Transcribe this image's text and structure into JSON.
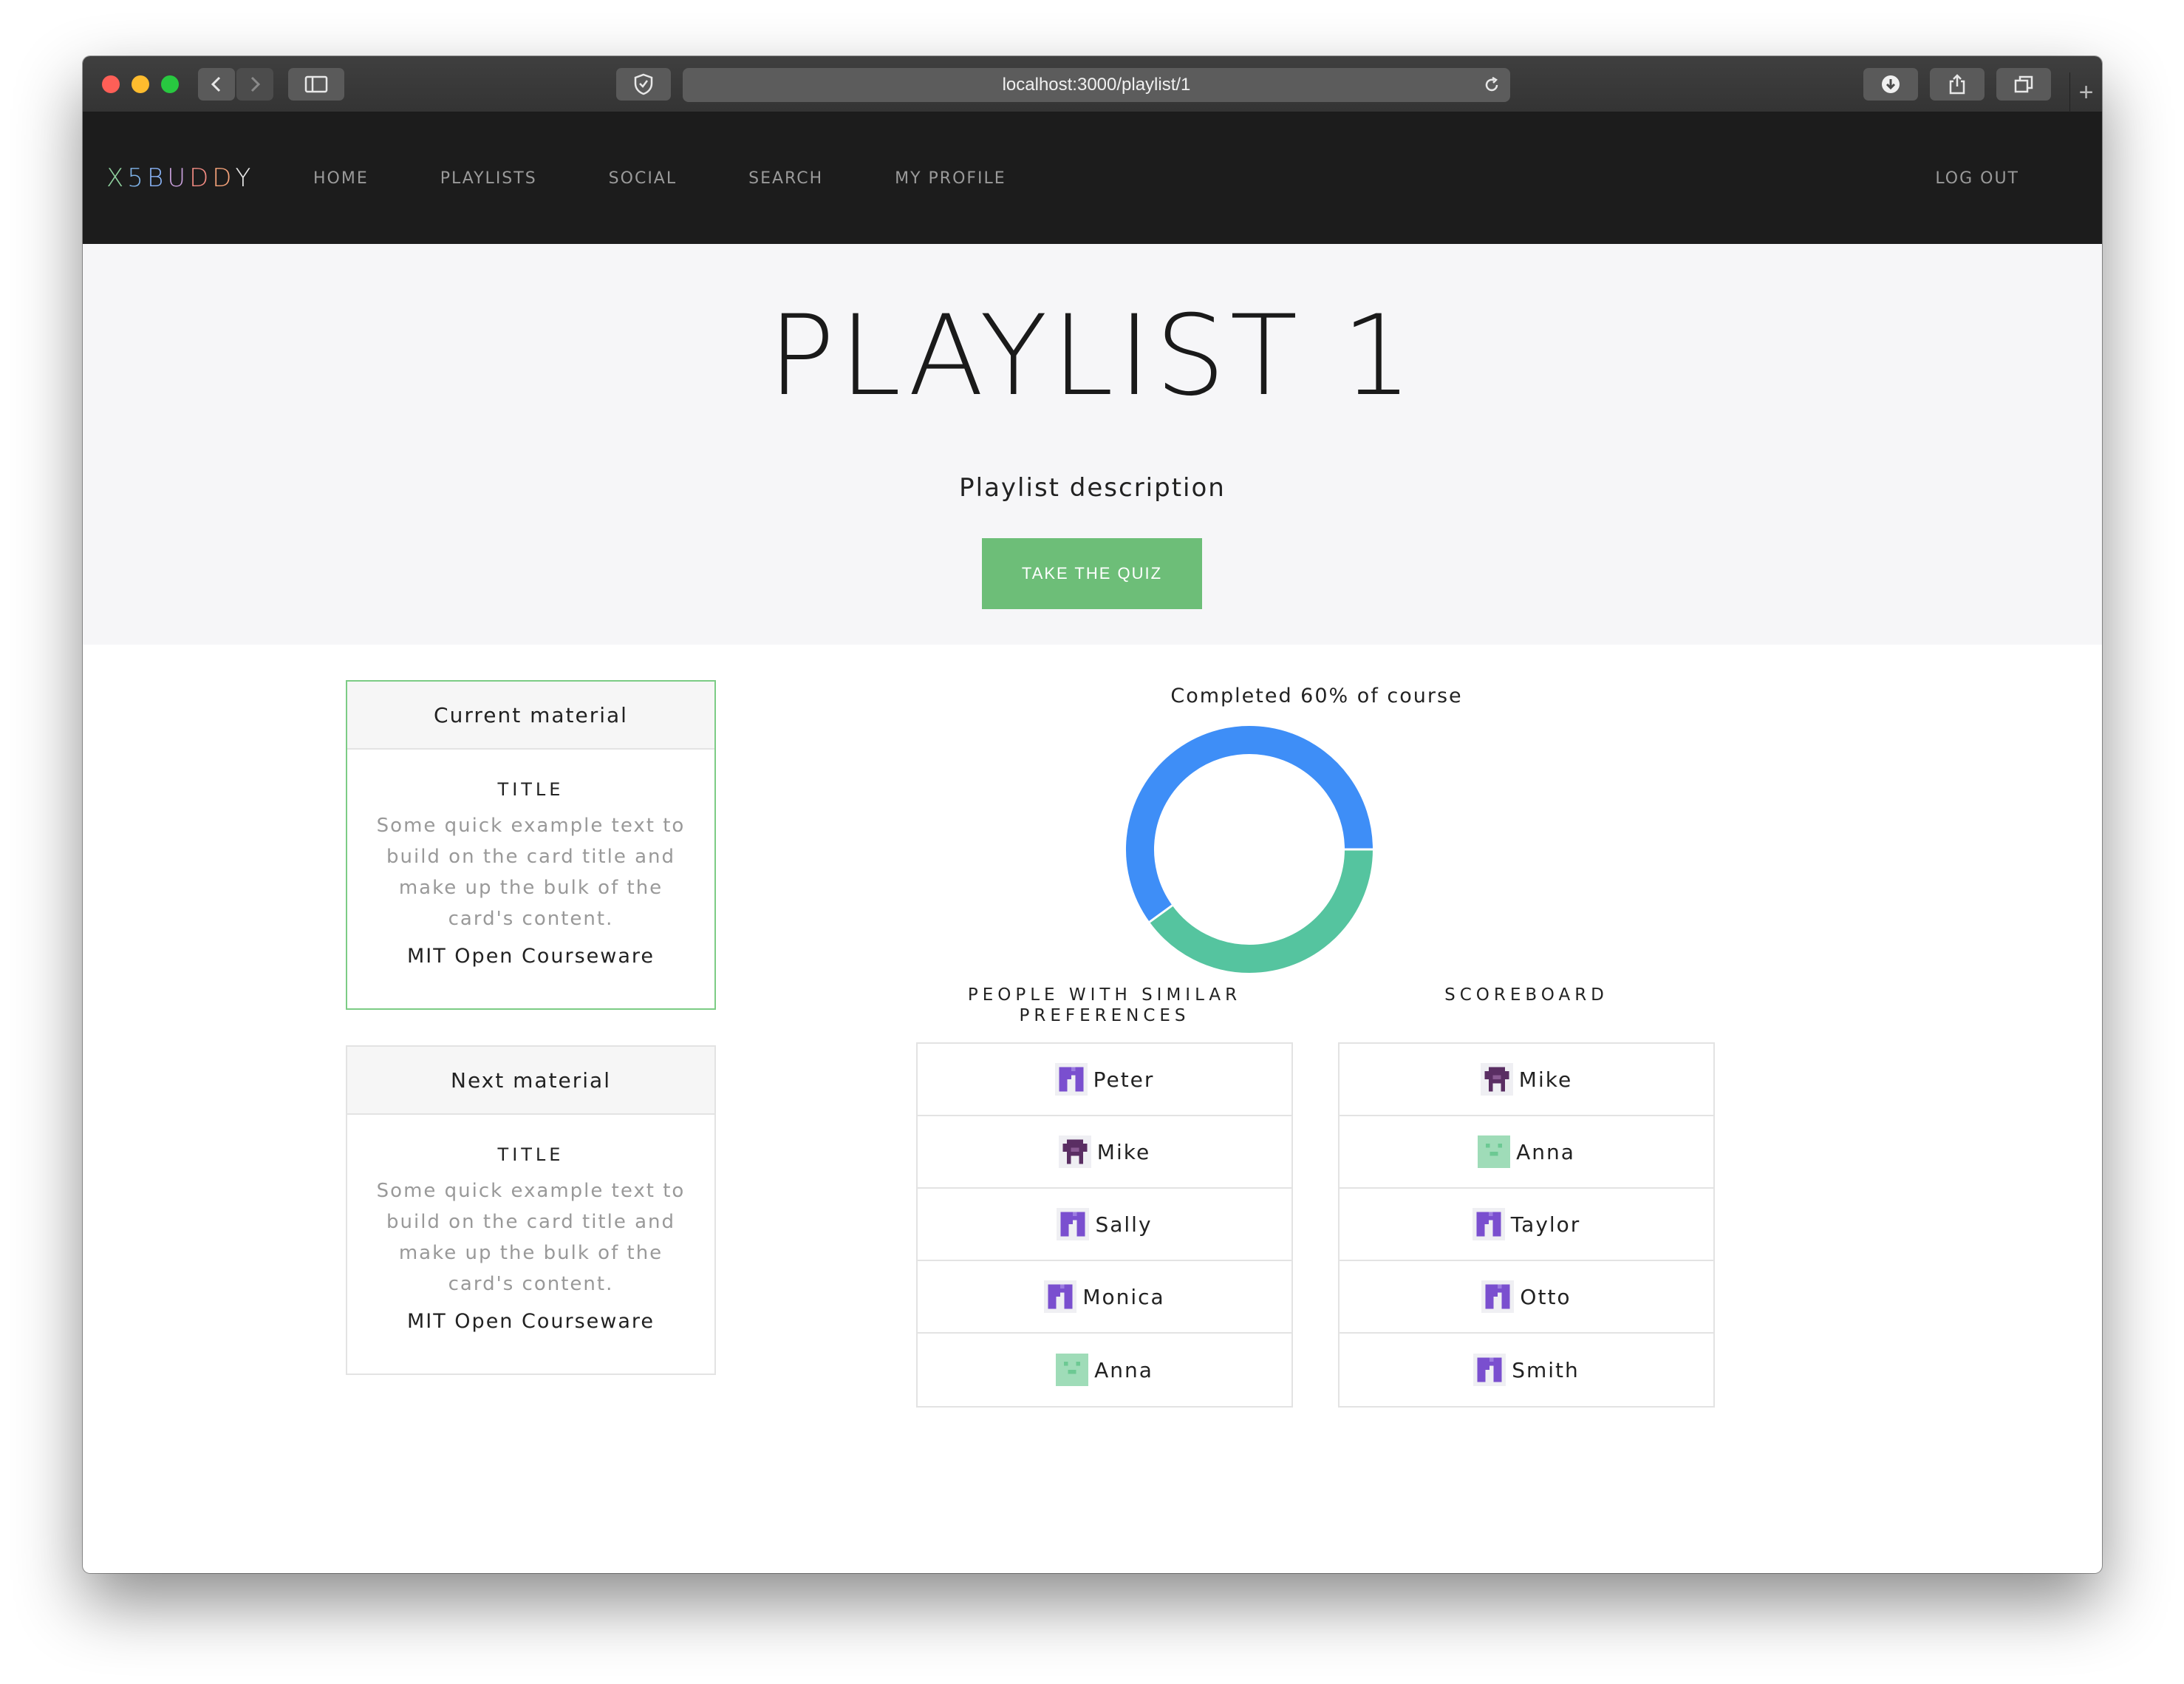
{
  "browser": {
    "url": "localhost:3000/playlist/1"
  },
  "nav": {
    "brand_letters": [
      {
        "char": "X",
        "color": "#8fd19e"
      },
      {
        "char": "5",
        "color": "#7fb3e8"
      },
      {
        "char": "B",
        "color": "#8ab4f8"
      },
      {
        "char": "U",
        "color": "#c9a0dc"
      },
      {
        "char": "D",
        "color": "#f28b82"
      },
      {
        "char": "D",
        "color": "#f6a37a"
      },
      {
        "char": "Y",
        "color": "#e8e8e8"
      }
    ],
    "links": [
      "HOME",
      "PLAYLISTS",
      "SOCIAL",
      "SEARCH",
      "MY PROFILE"
    ],
    "logout": "LOG OUT"
  },
  "hero": {
    "title": "PLAYLIST 1",
    "description": "Playlist description",
    "button": "TAKE THE QUIZ"
  },
  "current_material": {
    "header": "Current material",
    "title": "TITLE",
    "text": "Some quick example text to build on the card title and make up the bulk of the card's content.",
    "source": "MIT Open Courseware"
  },
  "next_material": {
    "header": "Next material",
    "title": "TITLE",
    "text": "Some quick example text to build on the card title and make up the bulk of the card's content.",
    "source": "MIT Open Courseware"
  },
  "progress": {
    "label": "Completed 60% of course",
    "completed_fraction": 0.6,
    "completed_color": "#3e8ef7",
    "remaining_color": "#55c49f"
  },
  "similar": {
    "title": "PEOPLE WITH SIMILAR PREFERENCES",
    "people": [
      {
        "name": "Peter",
        "icon": "avatar-purple-arch-icon"
      },
      {
        "name": "Mike",
        "icon": "avatar-dark-skull-icon"
      },
      {
        "name": "Sally",
        "icon": "avatar-purple-arch-icon"
      },
      {
        "name": "Monica",
        "icon": "avatar-purple-arch-icon"
      },
      {
        "name": "Anna",
        "icon": "avatar-green-face-icon"
      }
    ]
  },
  "scoreboard": {
    "title": "SCOREBOARD",
    "people": [
      {
        "name": "Mike",
        "icon": "avatar-dark-skull-icon"
      },
      {
        "name": "Anna",
        "icon": "avatar-green-face-icon"
      },
      {
        "name": "Taylor",
        "icon": "avatar-purple-arch-icon"
      },
      {
        "name": "Otto",
        "icon": "avatar-purple-arch-icon"
      },
      {
        "name": "Smith",
        "icon": "avatar-purple-arch-icon"
      }
    ]
  }
}
